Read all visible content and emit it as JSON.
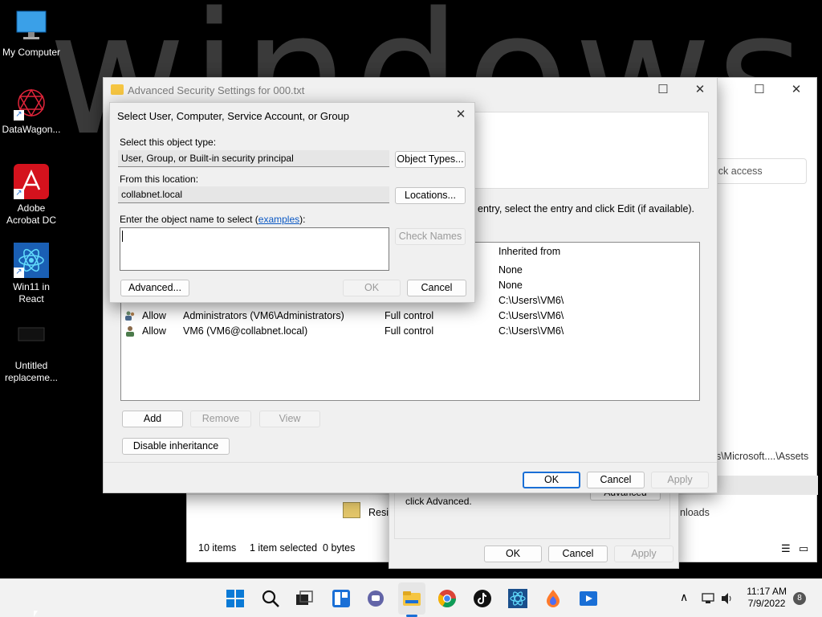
{
  "desktop": {
    "wallpaper_text": "windows",
    "icons": [
      {
        "label": "My Computer"
      },
      {
        "label": "DataWagon..."
      },
      {
        "label": "Adobe Acrobat DC"
      },
      {
        "label": "Win11 in React"
      },
      {
        "label": "Untitled replaceme..."
      }
    ]
  },
  "explorer": {
    "search_placeholder": "ick access",
    "path_text": "es\\Microsoft....\\Assets",
    "downloads_text": "nloads",
    "item_name": "Resic",
    "status_items": "10 items",
    "status_selected": "1 item selected  0 bytes"
  },
  "properties": {
    "hint": "click Advanced.",
    "advanced_label": "Advanced",
    "ok_label": "OK",
    "cancel_label": "Cancel",
    "apply_label": "Apply"
  },
  "advanced_security": {
    "title": "Advanced Security Settings for 000.txt",
    "instruction": "entry, select the entry and click Edit (if available).",
    "column_inherited": "Inherited from",
    "rows": [
      {
        "type": "",
        "principal": "",
        "access": "",
        "inherited": "None"
      },
      {
        "type": "",
        "principal": "",
        "access": "",
        "inherited": "None"
      },
      {
        "type": "",
        "principal": "",
        "access": "",
        "inherited": "C:\\Users\\VM6\\"
      },
      {
        "type": "Allow",
        "principal": "Administrators (VM6\\Administrators)",
        "access": "Full control",
        "inherited": "C:\\Users\\VM6\\"
      },
      {
        "type": "Allow",
        "principal": "VM6 (VM6@collabnet.local)",
        "access": "Full control",
        "inherited": "C:\\Users\\VM6\\"
      }
    ],
    "add_label": "Add",
    "remove_label": "Remove",
    "view_label": "View",
    "disable_inheritance_label": "Disable inheritance",
    "ok_label": "OK",
    "cancel_label": "Cancel",
    "apply_label": "Apply"
  },
  "select_dialog": {
    "title": "Select User, Computer, Service Account, or Group",
    "object_type_label": "Select this object type:",
    "object_type_value": "User, Group, or Built-in security principal",
    "object_types_button": "Object Types...",
    "location_label": "From this location:",
    "location_value": "collabnet.local",
    "locations_button": "Locations...",
    "enter_label_prefix": "Enter the object name to select (",
    "examples_link": "examples",
    "enter_label_suffix": "):",
    "object_name_value": "",
    "check_names_button": "Check Names",
    "advanced_button": "Advanced...",
    "ok_button": "OK",
    "cancel_button": "Cancel"
  },
  "taskbar": {
    "time": "11:17 AM",
    "date": "7/9/2022",
    "notification_count": "8"
  }
}
